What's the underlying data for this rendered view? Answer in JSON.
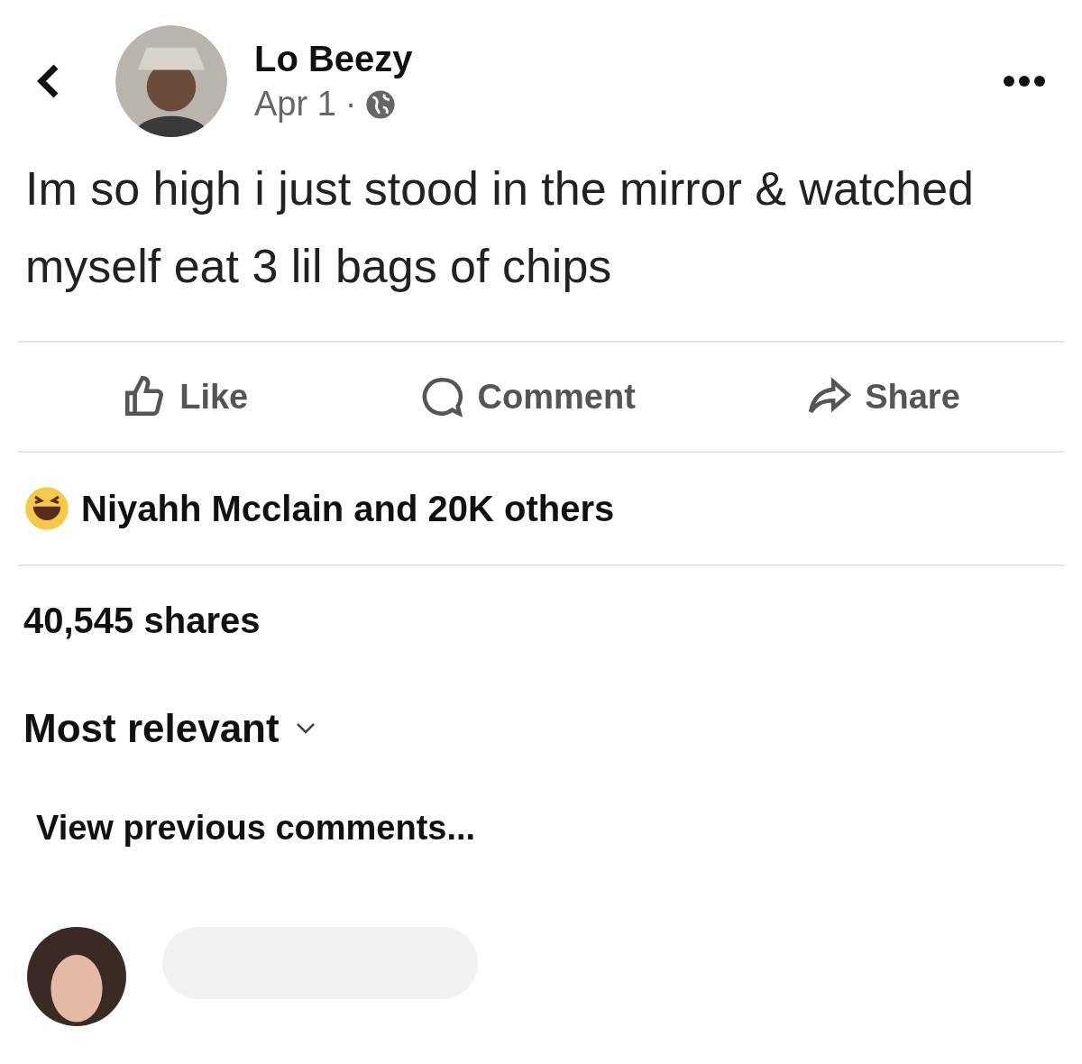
{
  "post": {
    "author": "Lo Beezy",
    "date": "Apr 1",
    "separator": "·",
    "text": "Im so high i just stood in the mirror & watched myself eat 3 lil bags of chips"
  },
  "actions": [
    {
      "kind": "like",
      "label": "Like"
    },
    {
      "kind": "comment",
      "label": "Comment"
    },
    {
      "kind": "share",
      "label": "Share"
    }
  ],
  "reactions": {
    "summary": "Niyahh Mcclain and 20K others"
  },
  "shares": "40,545 shares",
  "sort": {
    "label": "Most relevant"
  },
  "view_previous": "View previous comments..."
}
